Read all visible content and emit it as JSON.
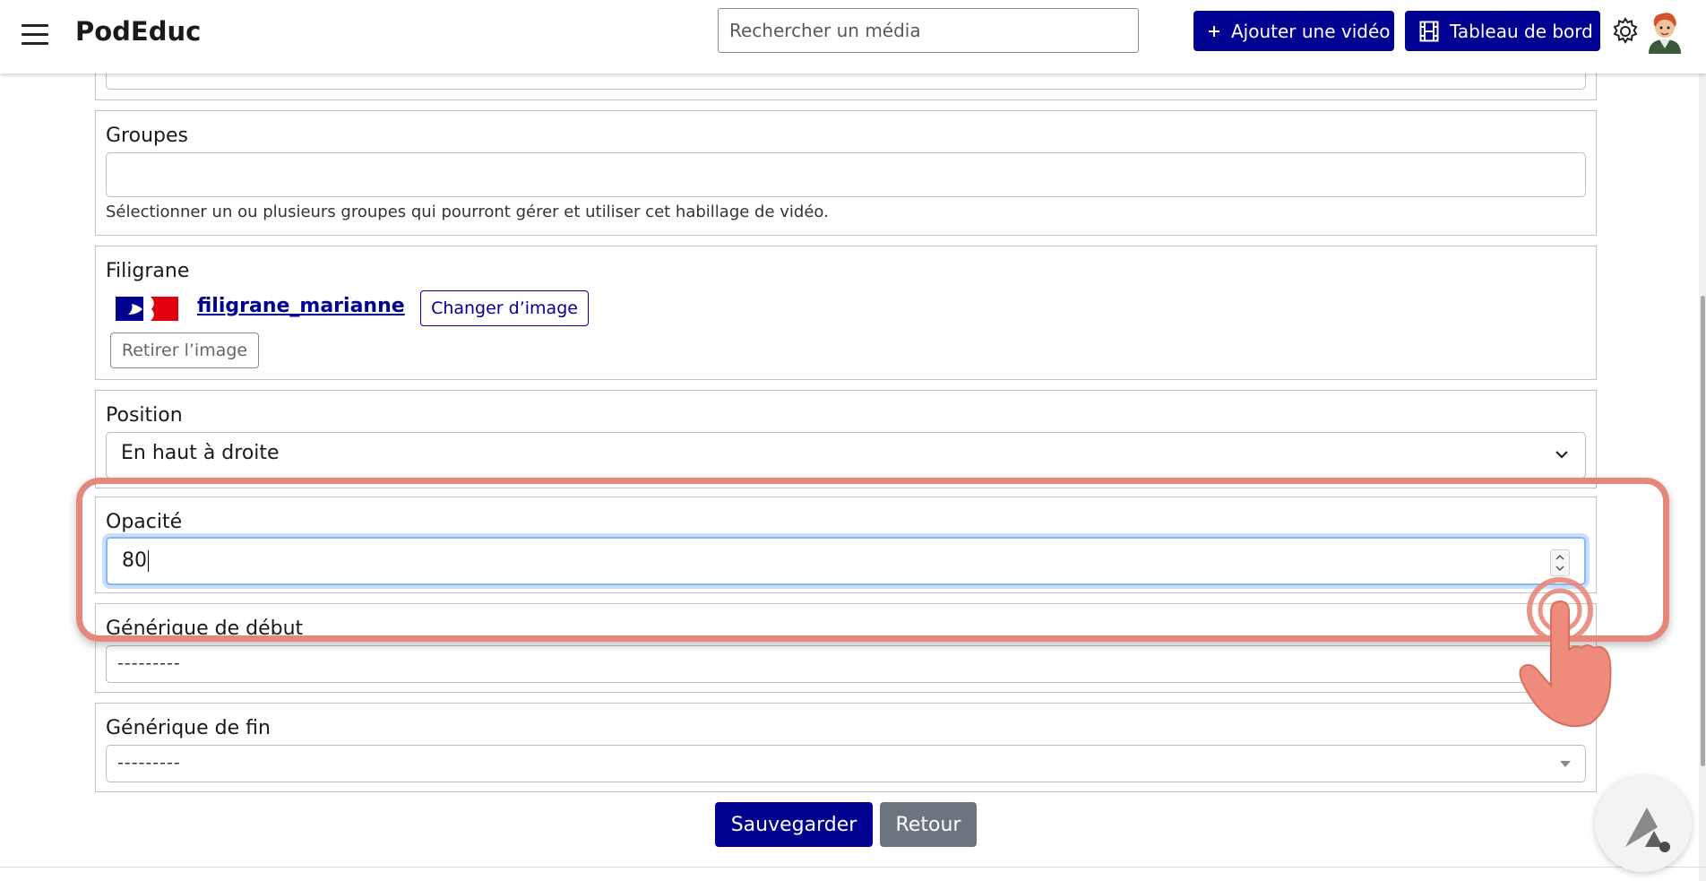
{
  "header": {
    "brand": "PodEduc",
    "search_placeholder": "Rechercher un média",
    "add_video_label": "Ajouter une vidéo",
    "dashboard_label": "Tableau de bord"
  },
  "form": {
    "groupes": {
      "label": "Groupes",
      "value": "",
      "help": "Sélectionner un ou plusieurs groupes qui pourront gérer et utiliser cet habillage de vidéo."
    },
    "filigrane": {
      "label": "Filigrane",
      "file_name": "filigrane_marianne",
      "change_label": "Changer d’image",
      "remove_label": "Retirer l’image"
    },
    "position": {
      "label": "Position",
      "selected": "En haut à droite"
    },
    "opacite": {
      "label": "Opacité",
      "value": "80"
    },
    "generique_debut": {
      "label": "Générique de début",
      "selected": "---------"
    },
    "generique_fin": {
      "label": "Générique de fin",
      "selected": "---------"
    },
    "save_label": "Sauvegarder",
    "back_label": "Retour"
  },
  "colors": {
    "primary": "#000091",
    "secondary": "#6c757d",
    "highlight": "#e5887a"
  }
}
